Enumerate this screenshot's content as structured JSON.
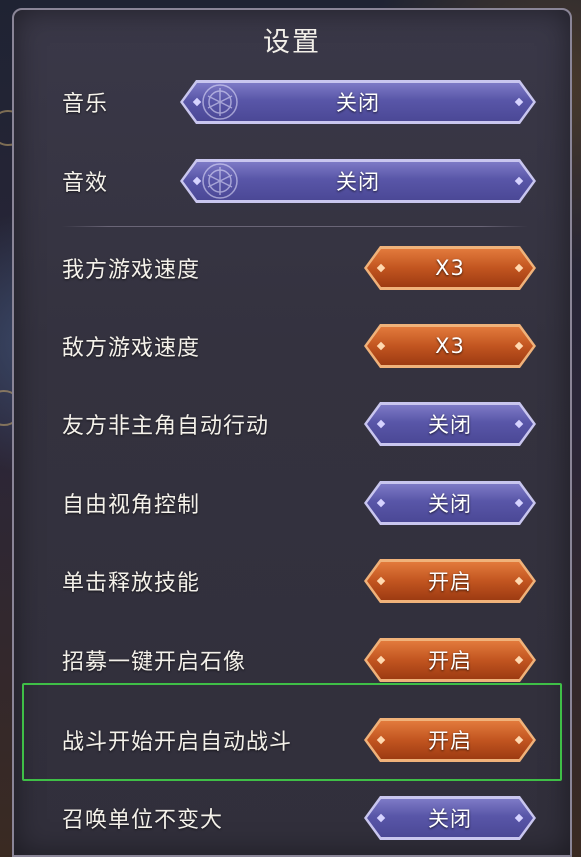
{
  "title": "设置",
  "colors": {
    "blue_button": "#5956a8",
    "orange_button": "#c25520",
    "highlight_border": "#3fbf47",
    "panel_bg": "#34323f"
  },
  "settings": [
    {
      "label": "音乐",
      "value": "关闭",
      "style": "blue",
      "width": "wide"
    },
    {
      "label": "音效",
      "value": "关闭",
      "style": "blue",
      "width": "wide"
    },
    {
      "label": "我方游戏速度",
      "value": "X3",
      "style": "orange",
      "width": "narrow"
    },
    {
      "label": "敌方游戏速度",
      "value": "X3",
      "style": "orange",
      "width": "narrow"
    },
    {
      "label": "友方非主角自动行动",
      "value": "关闭",
      "style": "blue",
      "width": "narrow"
    },
    {
      "label": "自由视角控制",
      "value": "关闭",
      "style": "blue",
      "width": "narrow"
    },
    {
      "label": "单击释放技能",
      "value": "开启",
      "style": "orange",
      "width": "narrow"
    },
    {
      "label": "招募一键开启石像",
      "value": "开启",
      "style": "orange",
      "width": "narrow"
    },
    {
      "label": "战斗开始开启自动战斗",
      "value": "开启",
      "style": "orange",
      "width": "narrow",
      "highlighted": true
    },
    {
      "label": "召唤单位不变大",
      "value": "关闭",
      "style": "blue",
      "width": "narrow"
    }
  ]
}
